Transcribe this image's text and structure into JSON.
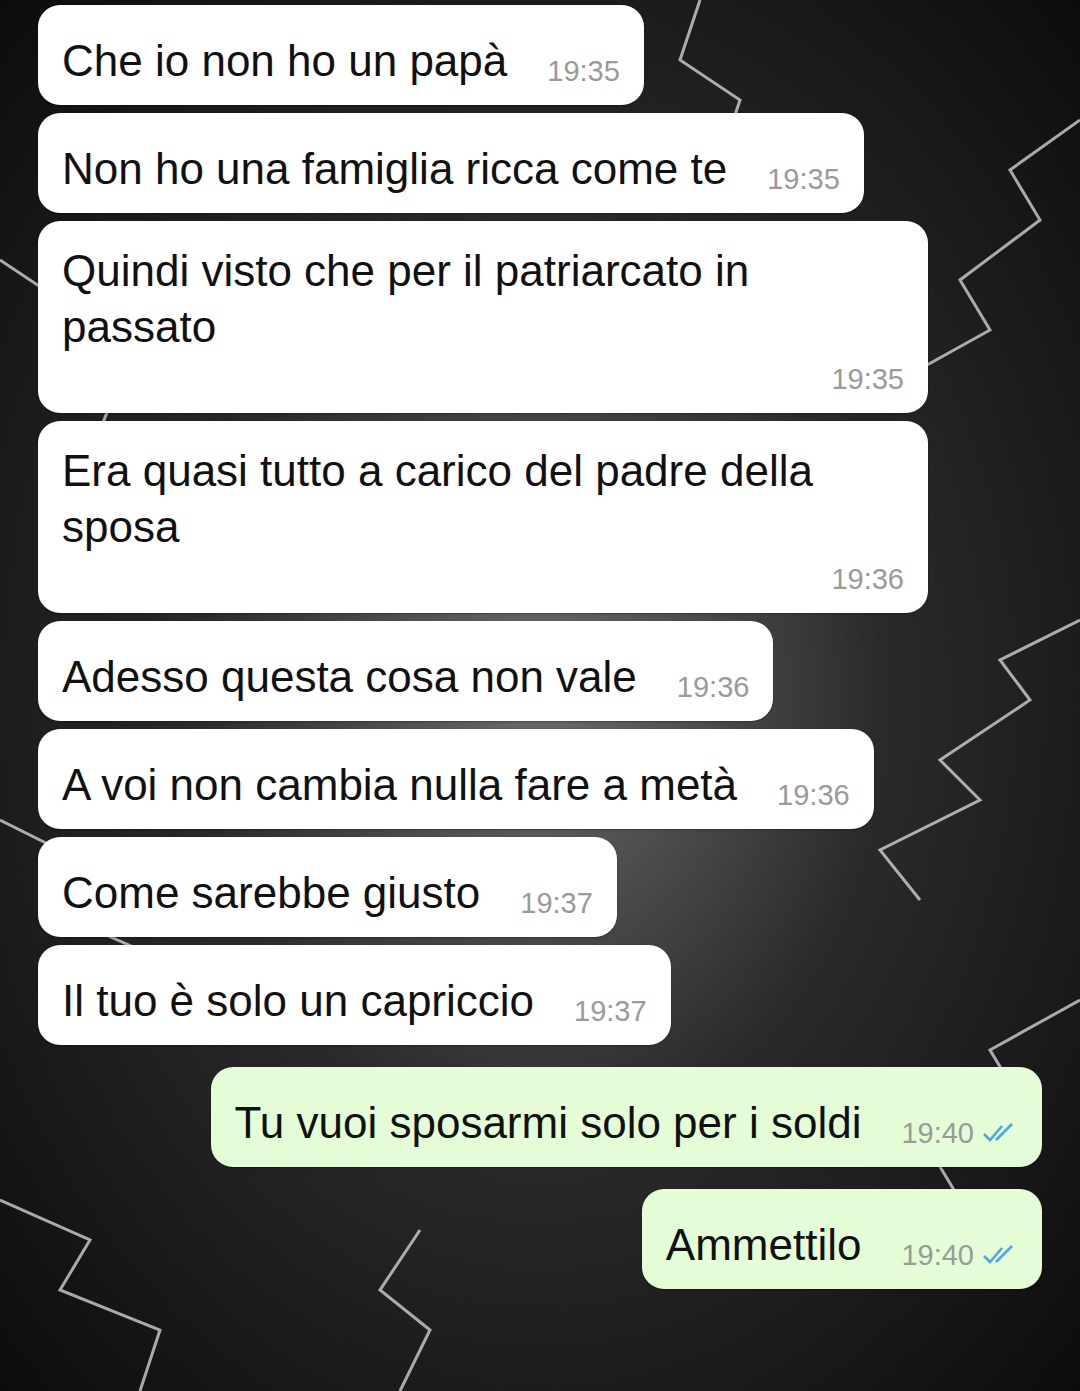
{
  "chat": {
    "messages": [
      {
        "text": "Che io non ho un papà",
        "time": "19:35",
        "kind": "incoming",
        "read": false
      },
      {
        "text": "Non ho una famiglia ricca come te",
        "time": "19:35",
        "kind": "incoming",
        "read": false
      },
      {
        "text": "Quindi visto che per il patriarcato in passato",
        "time": "19:35",
        "kind": "incoming",
        "read": false
      },
      {
        "text": "Era quasi tutto a carico del padre della sposa",
        "time": "19:36",
        "kind": "incoming",
        "read": false
      },
      {
        "text": "Adesso questa cosa non vale",
        "time": "19:36",
        "kind": "incoming",
        "read": false
      },
      {
        "text": "A voi non cambia nulla fare a metà",
        "time": "19:36",
        "kind": "incoming",
        "read": false
      },
      {
        "text": "Come sarebbe giusto",
        "time": "19:37",
        "kind": "incoming",
        "read": false
      },
      {
        "text": "Il tuo è solo un capriccio",
        "time": "19:37",
        "kind": "incoming",
        "read": false
      },
      {
        "text": "Tu vuoi sposarmi solo per i soldi",
        "time": "19:40",
        "kind": "outgoing",
        "read": true
      },
      {
        "text": "Ammettilo",
        "time": "19:40",
        "kind": "outgoing",
        "read": true
      }
    ]
  }
}
